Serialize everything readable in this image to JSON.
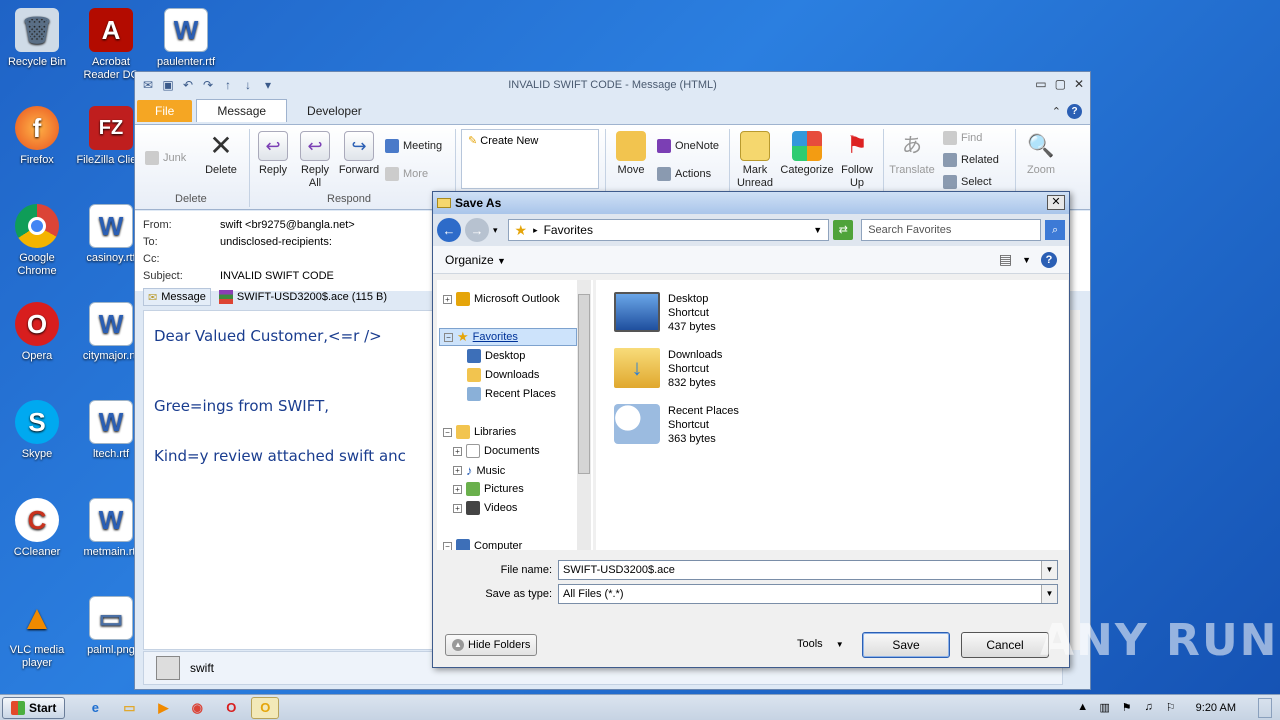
{
  "desktop": {
    "icons": [
      {
        "label": "Recycle Bin",
        "glyph": "🗑",
        "color": "#9fb4c8"
      },
      {
        "label": "Acrobat Reader DC",
        "glyph": "A",
        "color": "#b30b00"
      },
      {
        "label": "paulenter.rtf",
        "glyph": "W",
        "color": "#2b5fb4"
      },
      {
        "label": "Firefox",
        "glyph": "🦊",
        "color": "#ff7a1a"
      },
      {
        "label": "FileZilla Client",
        "glyph": "FZ",
        "color": "#bf1e1e"
      },
      {
        "label": "Google Chrome",
        "glyph": "◉",
        "color": "#3b8fe0"
      },
      {
        "label": "casinoy.rtf",
        "glyph": "W",
        "color": "#2b5fb4"
      },
      {
        "label": "Opera",
        "glyph": "O",
        "color": "#d81e1e"
      },
      {
        "label": "citymajor.rtf",
        "glyph": "W",
        "color": "#2b5fb4"
      },
      {
        "label": "Skype",
        "glyph": "S",
        "color": "#00a9f0"
      },
      {
        "label": "ltech.rtf",
        "glyph": "W",
        "color": "#2b5fb4"
      },
      {
        "label": "CCleaner",
        "glyph": "C",
        "color": "#c8321e"
      },
      {
        "label": "metmain.rtf",
        "glyph": "W",
        "color": "#2b5fb4"
      },
      {
        "label": "VLC media player",
        "glyph": "▲",
        "color": "#f08a00"
      },
      {
        "label": "palml.png",
        "glyph": "▭",
        "color": "#4a6fa5"
      }
    ]
  },
  "outlook": {
    "title": "INVALID SWIFT CODE  -  Message (HTML)",
    "tabs": {
      "file": "File",
      "message": "Message",
      "developer": "Developer"
    },
    "ribbon": {
      "junk": "Junk",
      "delete": "Delete",
      "reply": "Reply",
      "reply_all": "Reply All",
      "forward": "Forward",
      "meeting": "Meeting",
      "more": "More",
      "create_new": "Create New",
      "move": "Move",
      "onenote": "OneNote",
      "actions": "Actions",
      "mark_unread": "Mark Unread",
      "categorize": "Categorize",
      "follow_up": "Follow Up",
      "translate": "Translate",
      "find": "Find",
      "related": "Related",
      "select": "Select",
      "zoom": "Zoom",
      "group_delete": "Delete",
      "group_respond": "Respond"
    },
    "header": {
      "from_label": "From:",
      "from_value": "swift <br9275@bangla.net>",
      "to_label": "To:",
      "to_value": "undisclosed-recipients:",
      "cc_label": "Cc:",
      "cc_value": "",
      "subject_label": "Subject:",
      "subject_value": "INVALID SWIFT CODE"
    },
    "attachments": {
      "message": "Message",
      "file": "SWIFT-USD3200$.ace (115 B)"
    },
    "body": {
      "line1": "Dear Valued Customer,<=r />",
      "line2": "Gree=ings from SWIFT,",
      "line3": "Kind=y review attached swift anc"
    },
    "people_pane": {
      "name": "swift"
    }
  },
  "save_as": {
    "title": "Save As",
    "address": "Favorites",
    "search_placeholder": "Search Favorites",
    "organize": "Organize",
    "tree": [
      {
        "label": "Microsoft Outlook"
      },
      {
        "label": "Favorites"
      },
      {
        "label": "Desktop"
      },
      {
        "label": "Downloads"
      },
      {
        "label": "Recent Places"
      },
      {
        "label": "Libraries"
      },
      {
        "label": "Documents"
      },
      {
        "label": "Music"
      },
      {
        "label": "Pictures"
      },
      {
        "label": "Videos"
      },
      {
        "label": "Computer"
      }
    ],
    "files": [
      {
        "name": "Desktop",
        "type": "Shortcut",
        "size": "437 bytes"
      },
      {
        "name": "Downloads",
        "type": "Shortcut",
        "size": "832 bytes"
      },
      {
        "name": "Recent Places",
        "type": "Shortcut",
        "size": "363 bytes"
      }
    ],
    "file_name_label": "File name:",
    "file_name_value": "SWIFT-USD3200$.ace",
    "save_type_label": "Save as type:",
    "save_type_value": "All Files (*.*)",
    "hide_folders": "Hide Folders",
    "tools": "Tools",
    "save": "Save",
    "cancel": "Cancel"
  },
  "taskbar": {
    "start": "Start",
    "clock": "9:20 AM"
  },
  "watermark": "ANY RUN"
}
